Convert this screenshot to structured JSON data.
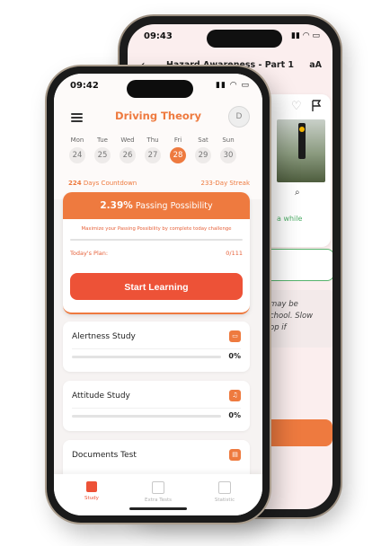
{
  "back_phone": {
    "time": "09:43",
    "status": "▮▮ ◠ ▭",
    "title": "Hazard Awareness - Part 1",
    "back_arrow": "‹",
    "text_size": "aA",
    "icons": [
      "heart-icon",
      "flag-icon",
      "zoom-icon"
    ],
    "hint_partial": "a while",
    "italic_lines": [
      "may be",
      "chool. Slow",
      "op if"
    ]
  },
  "front_phone": {
    "time": "09:42",
    "status": "▮▮ ◠ ▭",
    "app_title": "Driving Theory",
    "avatar_initial": "D",
    "week": [
      {
        "name": "Mon",
        "num": "24"
      },
      {
        "name": "Tue",
        "num": "25"
      },
      {
        "name": "Wed",
        "num": "26"
      },
      {
        "name": "Thu",
        "num": "27"
      },
      {
        "name": "Fri",
        "num": "28"
      },
      {
        "name": "Sat",
        "num": "29"
      },
      {
        "name": "Sun",
        "num": "30"
      }
    ],
    "active_day_index": 4,
    "countdown_num": "224",
    "countdown_label": "Days Countdown",
    "streak": "233-Day Streak",
    "passing_percent": "2.39%",
    "passing_label": "Passing Possibility",
    "maximize_text": "Maximize your Passing Possibility by complete today challenge",
    "plan_label": "Today's Plan:",
    "plan_count": "0/111",
    "start_button": "Start Learning",
    "study_cards": [
      {
        "title": "Alertness Study",
        "pct": "0%",
        "progress": 0
      },
      {
        "title": "Attitude Study",
        "pct": "0%",
        "progress": 0
      },
      {
        "title": "Documents Test",
        "pct": "",
        "progress": 0
      }
    ],
    "tabs": [
      {
        "label": "Study"
      },
      {
        "label": "Extra Tests"
      },
      {
        "label": "Statistic"
      }
    ],
    "accent_color": "#ee7a3f",
    "button_color": "#ed5237"
  }
}
